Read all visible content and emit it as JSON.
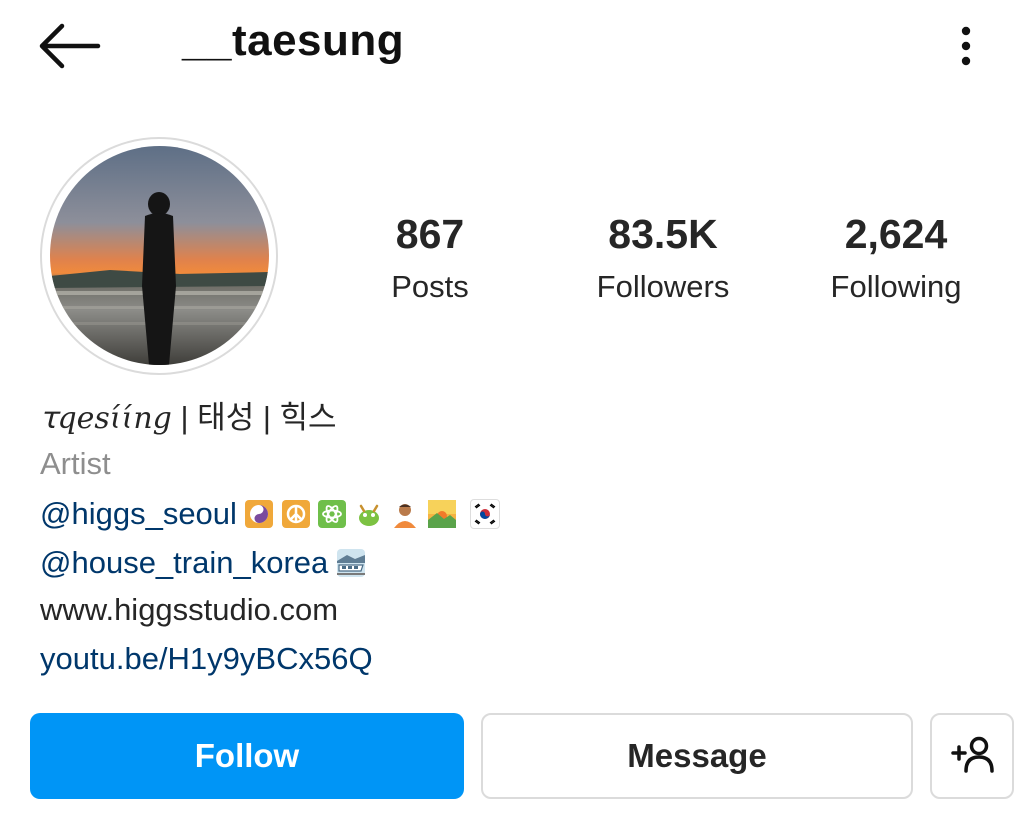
{
  "header": {
    "username": "__taesung"
  },
  "stats": [
    {
      "value": "867",
      "label": "Posts"
    },
    {
      "value": "83.5K",
      "label": "Followers"
    },
    {
      "value": "2,624",
      "label": "Following"
    }
  ],
  "bio": {
    "name_fancy": "ꚍqesɩ́ɩ́ng",
    "name_rest": " | 태성 | 힉스",
    "category": "Artist",
    "mention1": "@higgs_seoul",
    "mention1_emojis": [
      "yin-yang",
      "peace",
      "atom",
      "dragon",
      "person-bowing",
      "sunrise",
      "korea-flag"
    ],
    "mention2": "@house_train_korea",
    "mention2_emojis": [
      "train"
    ],
    "website": "www.higgsstudio.com",
    "youtube": "youtu.be/H1y9yBCx56Q"
  },
  "buttons": {
    "follow": "Follow",
    "message": "Message",
    "add_user_icon": "add-user-icon"
  },
  "colors": {
    "follow_blue": "#0095f6",
    "link_blue": "#00376b",
    "muted_gray": "#8e8e8e",
    "border_gray": "#dbdbdb"
  }
}
